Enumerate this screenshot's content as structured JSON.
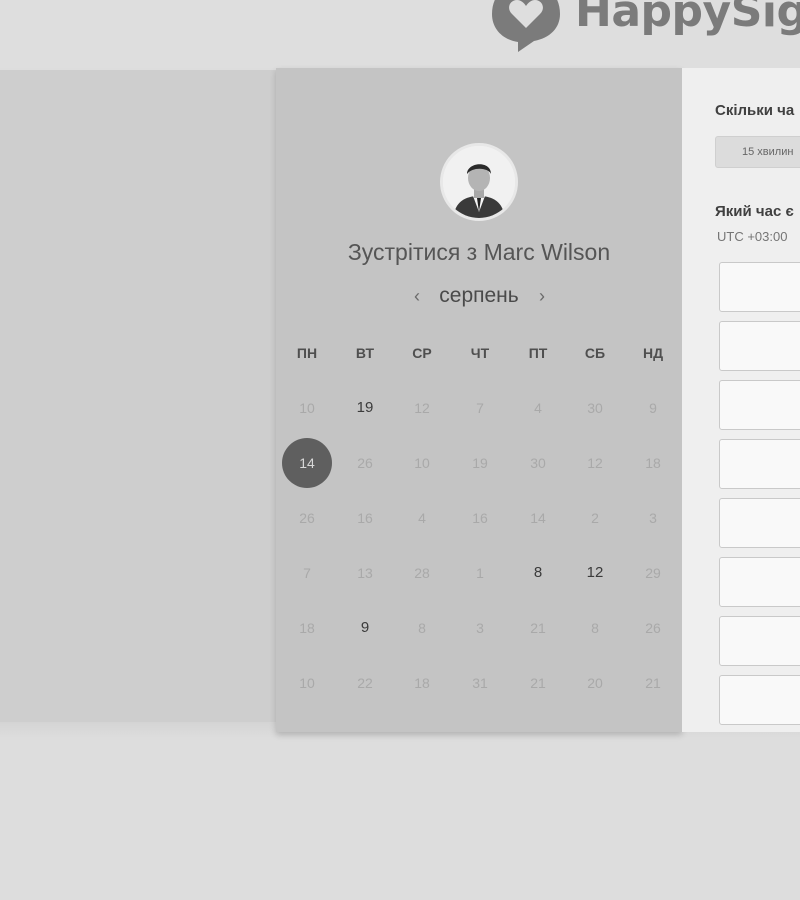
{
  "brand": {
    "name": "HappySign",
    "logo_icon": "speech-bubble-heart-icon"
  },
  "profile": {
    "avatar_icon": "user-avatar-photo",
    "meet_title": "Зустрітися з Marc Wilson"
  },
  "month_nav": {
    "prev": "‹",
    "label": "серпень",
    "next": "›"
  },
  "weekdays": [
    "ПН",
    "ВТ",
    "СР",
    "ЧТ",
    "ПТ",
    "СБ",
    "НД"
  ],
  "days": [
    [
      {
        "n": "10"
      },
      {
        "n": "19",
        "s": "available"
      },
      {
        "n": "12"
      },
      {
        "n": "7"
      },
      {
        "n": "4"
      },
      {
        "n": "30"
      },
      {
        "n": "9"
      }
    ],
    [
      {
        "n": "14",
        "s": "selected"
      },
      {
        "n": "26"
      },
      {
        "n": "10"
      },
      {
        "n": "19"
      },
      {
        "n": "30"
      },
      {
        "n": "12"
      },
      {
        "n": "18"
      }
    ],
    [
      {
        "n": "26"
      },
      {
        "n": "16"
      },
      {
        "n": "4"
      },
      {
        "n": "16"
      },
      {
        "n": "14"
      },
      {
        "n": "2"
      },
      {
        "n": "3"
      }
    ],
    [
      {
        "n": "7"
      },
      {
        "n": "13"
      },
      {
        "n": "28"
      },
      {
        "n": "1"
      },
      {
        "n": "8",
        "s": "available"
      },
      {
        "n": "12",
        "s": "available"
      },
      {
        "n": "29"
      }
    ],
    [
      {
        "n": "18"
      },
      {
        "n": "9",
        "s": "available"
      },
      {
        "n": "8"
      },
      {
        "n": "3"
      },
      {
        "n": "21"
      },
      {
        "n": "8"
      },
      {
        "n": "26"
      }
    ],
    [
      {
        "n": "10"
      },
      {
        "n": "22"
      },
      {
        "n": "18"
      },
      {
        "n": "31"
      },
      {
        "n": "21"
      },
      {
        "n": "20"
      },
      {
        "n": "21"
      }
    ]
  ],
  "booking": {
    "duration_question": "Скільки ча",
    "duration_option": "15 хвилин",
    "time_question": "Який час є",
    "timezone": "UTC +03:00"
  },
  "colors": {
    "selected_day": "#5f5f5f",
    "calendar_bg": "#c4c4c4",
    "page_bg": "#dddddd"
  }
}
